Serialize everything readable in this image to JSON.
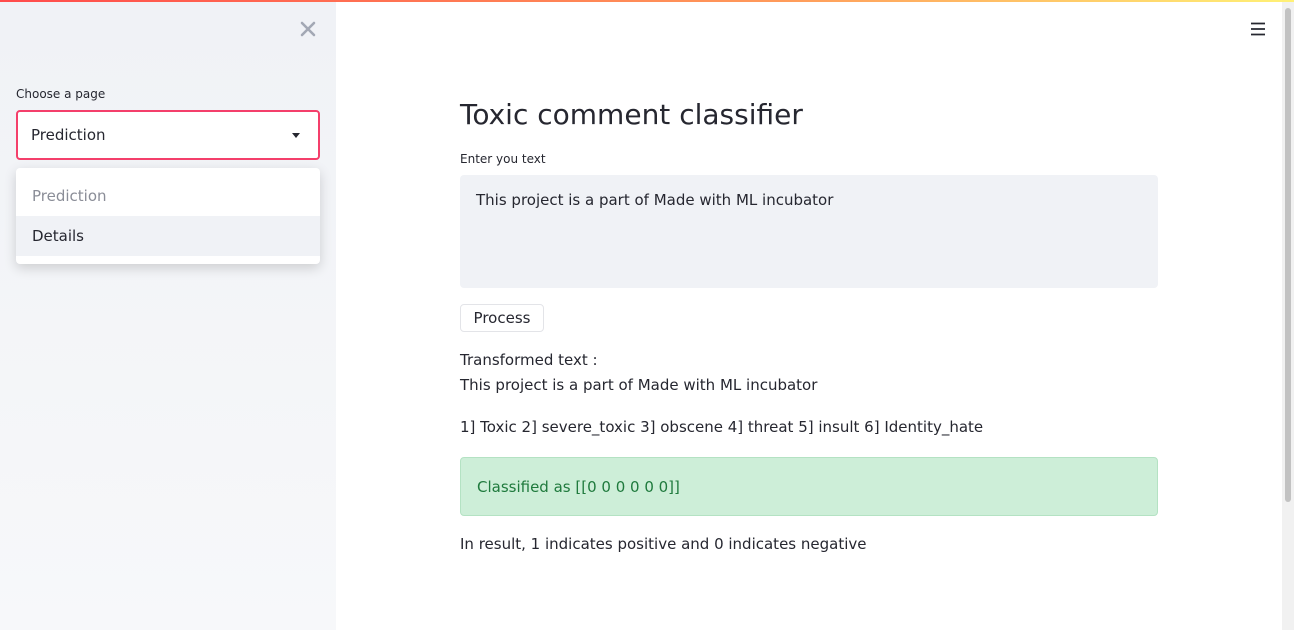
{
  "colors": {
    "accent": "#f43f6b",
    "sidebar_bg": "#f0f2f6",
    "success_bg": "#cdeed8",
    "success_text": "#1f7a3d"
  },
  "sidebar": {
    "close_icon": "close-icon",
    "select_label": "Choose a page",
    "selected_value": "Prediction",
    "options": [
      "Prediction",
      "Details"
    ]
  },
  "header": {
    "menu_icon": "hamburger-menu-icon"
  },
  "main": {
    "title": "Toxic comment classifier",
    "input_label": "Enter you text",
    "input_value": "This project is a part of Made with ML incubator",
    "process_button": "Process",
    "transformed_label": "Transformed text :",
    "transformed_value": "This project is a part of Made with ML incubator",
    "categories_line": "1] Toxic 2] severe_toxic 3] obscene 4] threat 5] insult 6] Identity_hate",
    "result": "Classified as [[0 0 0 0 0 0]]",
    "note": "In result, 1 indicates positive and 0 indicates negative"
  }
}
